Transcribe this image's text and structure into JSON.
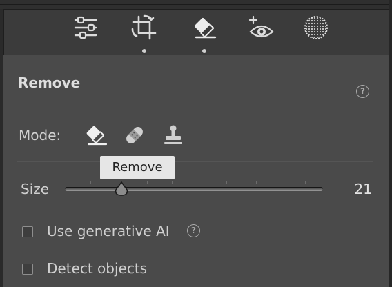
{
  "toolbar": {
    "tools": [
      {
        "icon": "sliders-icon",
        "label": "Edit"
      },
      {
        "icon": "crop-icon",
        "label": "Crop"
      },
      {
        "icon": "eraser-icon",
        "label": "Remove"
      },
      {
        "icon": "red-eye-icon",
        "label": "Red Eye"
      },
      {
        "icon": "masking-icon",
        "label": "Masking"
      }
    ]
  },
  "panel": {
    "title": "Remove",
    "mode_label": "Mode:",
    "modes": [
      {
        "icon": "eraser-icon",
        "name": "Remove"
      },
      {
        "icon": "bandage-icon",
        "name": "Heal"
      },
      {
        "icon": "stamp-icon",
        "name": "Clone"
      }
    ],
    "tooltip": "Remove",
    "size": {
      "label": "Size",
      "value": "21"
    },
    "options": {
      "generative_ai": {
        "label": "Use generative AI",
        "checked": false
      },
      "detect_objects": {
        "label": "Detect objects",
        "checked": false
      }
    }
  },
  "colors": {
    "panel_bg": "#4a4a4a",
    "frame_bg": "#3b3b3b",
    "text": "#d6d6d6",
    "tooltip_bg": "#e6e6e6"
  }
}
